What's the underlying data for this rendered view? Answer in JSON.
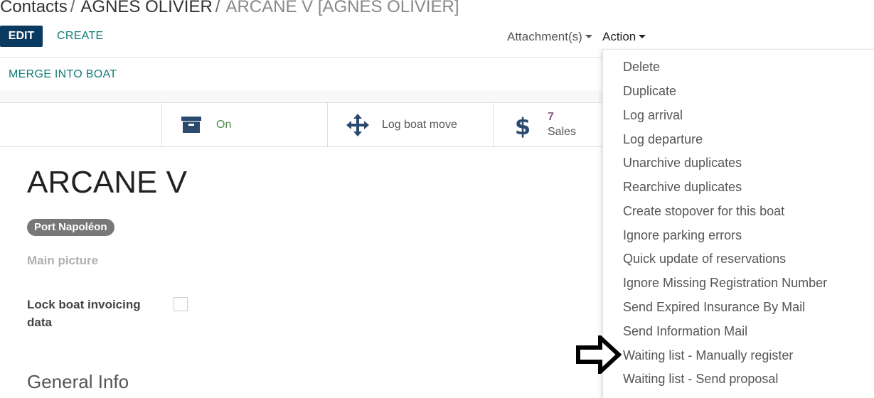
{
  "breadcrumb": {
    "items": [
      "Contacts",
      "AGNES OLIVIER",
      "ARCANE V [AGNES OLIVIER]"
    ],
    "separator": "/"
  },
  "toolbar": {
    "edit_label": "EDIT",
    "create_label": "CREATE",
    "attachments_label": "Attachment(s)",
    "action_label": "Action"
  },
  "statusbar": {
    "merge_label": "MERGE INTO BOAT"
  },
  "smart_buttons": {
    "active": {
      "label": "On",
      "icon": "archive-icon"
    },
    "log_move": {
      "label": "Log boat move",
      "icon": "move-arrows-icon"
    },
    "sales": {
      "count": "7",
      "label": "Sales",
      "icon": "dollar-icon"
    }
  },
  "form": {
    "title": "ARCANE V",
    "tag": "Port Napoléon",
    "main_picture_label": "Main picture",
    "lock_invoicing_label": "Lock boat invoicing data",
    "lock_invoicing_checked": false,
    "section_title": "General Info"
  },
  "action_menu": {
    "items": [
      "Delete",
      "Duplicate",
      "Log arrival",
      "Log departure",
      "Unarchive duplicates",
      "Rearchive duplicates",
      "Create stopover for this boat",
      "Ignore parking errors",
      "Quick update of reservations",
      "Ignore Missing Registration Number",
      "Send Expired Insurance By Mail",
      "Send Information Mail",
      "Waiting list - Manually register",
      "Waiting list - Send proposal"
    ],
    "pointed_item_index": 12
  },
  "colors": {
    "primary": "#0b3a60",
    "link": "#0f7b76",
    "active_green": "#558a4e",
    "count_purple": "#875a7b",
    "tag_gray": "#777777"
  }
}
